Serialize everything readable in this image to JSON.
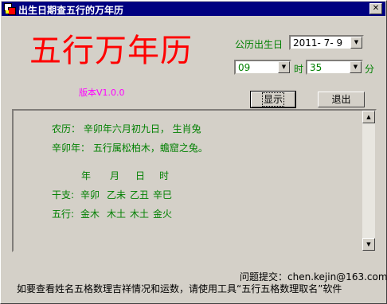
{
  "window": {
    "title": "出生日期查五行的万年历",
    "close_glyph": "✕"
  },
  "header": {
    "big_title": "五行万年历",
    "version": "版本V1.0.0"
  },
  "controls": {
    "birth_label": "公历出生日",
    "date_value": "2011- 7- 9",
    "hour_value": "09",
    "hour_label": "时",
    "minute_value": "35",
    "minute_label": "分",
    "show_button": "显示",
    "exit_button": "退出"
  },
  "result": {
    "lunar": "农历： 辛卯年六月初九日， 生肖兔",
    "year_info": "辛卯年： 五行属松柏木，蟾窟之兔。",
    "columns": [
      "年",
      "月",
      "日",
      "时"
    ],
    "ganzhi_label": "干支:",
    "ganzhi": [
      "辛卯",
      "乙未",
      "乙丑",
      "辛巳"
    ],
    "wuxing_label": "五行:",
    "wuxing": [
      "金木",
      "木土",
      "木土",
      "金火"
    ]
  },
  "footer": {
    "contact": "问题提交：chen.kejin@163.com",
    "note": "如要查看姓名五格数理吉祥情况和运数，请使用工具“五行五格数理取名”软件"
  },
  "colors": {
    "title_red": "#ff0000",
    "green_text": "#008000",
    "version_magenta": "#ff00ff",
    "titlebar": "#000080"
  },
  "icons": {
    "scroll_up": "▲",
    "scroll_down": "▼",
    "dropdown": "▼"
  }
}
